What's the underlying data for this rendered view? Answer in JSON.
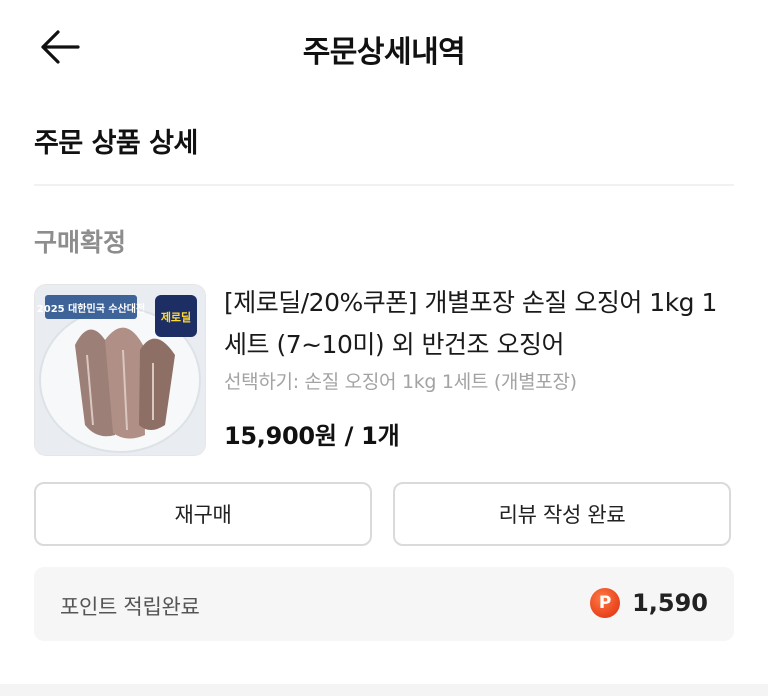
{
  "header": {
    "title": "주문상세내역",
    "back_icon": "arrow-left-icon"
  },
  "section": {
    "title": "주문 상품 상세"
  },
  "order": {
    "status": "구매확정",
    "product": {
      "name": "[제로딜/20%쿠폰] 개별포장 손질 오징어 1kg 1세트 (7~10미) 외 반건조 오징어",
      "option": "선택하기: 손질 오징어 1kg 1세트 (개별포장)",
      "price": "15,900원 / 1개",
      "thumb_badge": "제로딜",
      "thumb_banner": "2025 대한민국 수산대전"
    }
  },
  "actions": {
    "rebuy_label": "재구매",
    "review_label": "리뷰 작성 완료"
  },
  "points": {
    "label": "포인트 적립완료",
    "icon_letter": "P",
    "value": "1,590",
    "icon_color": "#e8421c"
  }
}
